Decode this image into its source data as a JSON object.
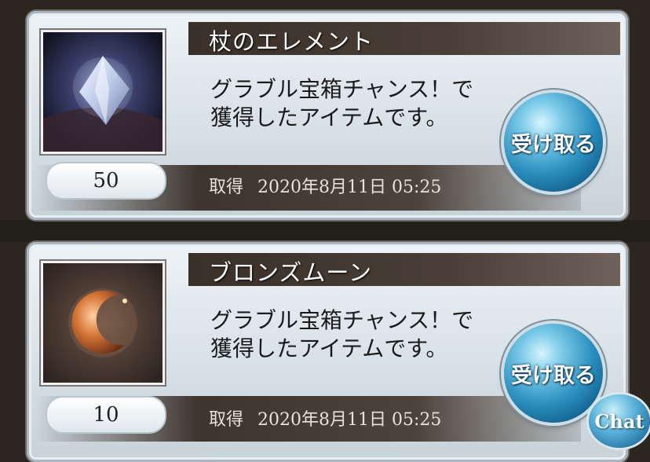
{
  "items": [
    {
      "name": "杖のエレメント",
      "description": "グラブル宝箱チャンス！で\n獲得したアイテムです。",
      "quantity": "50",
      "acquired_label": "取得",
      "acquired_date": "2020年8月11日 05:25",
      "receive_label": "受け取る",
      "icon": "crystal-element-icon"
    },
    {
      "name": "ブロンズムーン",
      "description": "グラブル宝箱チャンス！で\n獲得したアイテムです。",
      "quantity": "10",
      "acquired_label": "取得",
      "acquired_date": "2020年8月11日 05:25",
      "receive_label": "受け取る",
      "icon": "bronze-moon-icon"
    }
  ],
  "chat_label": "Chat",
  "colors": {
    "button_blue": "#2b8fbe",
    "title_bar": "#3a3029",
    "card_bg": "#dfe7ec"
  }
}
